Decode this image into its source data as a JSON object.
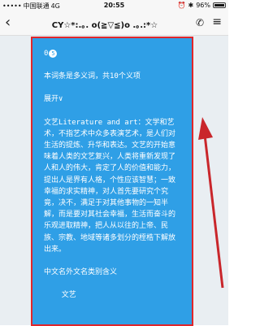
{
  "status": {
    "carrier": "中国联通",
    "network": "4G",
    "time": "20:55",
    "battery_text": "96%",
    "battery_level": 0.96
  },
  "nav": {
    "back_icon": "chevron-left-icon",
    "title": "CY☆*:.｡. o(≧▽≦)o .｡.:*☆",
    "call_icon": "phone-icon",
    "more_icon": "more-icon"
  },
  "message": {
    "header_prefix": "0",
    "header_badge": "5",
    "lines": [
      {
        "text": "本词条是多义词，共10个义项",
        "gap": true
      },
      {
        "text": "展开∨",
        "gap": true
      },
      {
        "text": "文艺Literature and art：文学和艺术，不指艺术中众多表演艺术，是人们对生活的提炼、升华和表达。文艺的开始意味着人类的文艺复兴，人类将重新发现了人和人的伟大，肯定了人的价值和能力，提出人是界有人格，个性应该智慧；一致幸福的求实精神，对人首先要研究个究竟，决不，满足于对其他事物的一知半解，而是要对其社会幸福，生活而奋斗的乐观进取精神，把人从以往的上帝、民族、宗教、地域等诸多划分的桎梏下解放出来。",
        "gap": true
      },
      {
        "text": "中文名外文名类别含义",
        "gap": true
      },
      {
        "text": "    文艺",
        "gap": false
      }
    ]
  },
  "colors": {
    "bubble": "#2f9fe6",
    "highlight_box": "#e0262b",
    "arrow": "#c9262b"
  }
}
